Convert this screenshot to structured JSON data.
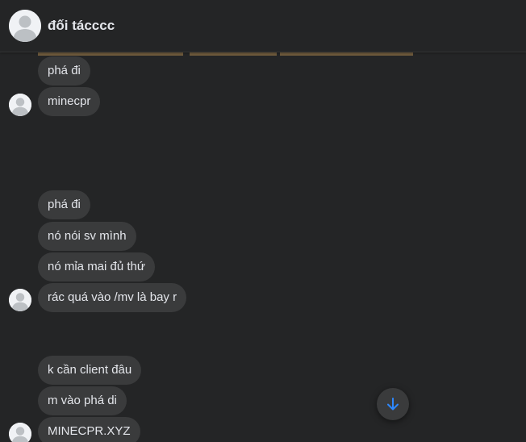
{
  "header": {
    "title": "đối tácccc"
  },
  "messages": [
    {
      "text": "phá đi"
    },
    {
      "text": "minecpr"
    },
    {
      "text": "phá đi"
    },
    {
      "text": "nó nói sv mình"
    },
    {
      "text": "nó mỉa mai đủ thứ"
    },
    {
      "text": "rác quá vào /mv là bay r"
    },
    {
      "text": "k cần client đâu"
    },
    {
      "text": "m vào phá di"
    },
    {
      "text": "MINECPR.XYZ"
    }
  ],
  "icons": {
    "avatar": "default-user-avatar-icon",
    "scroll": "arrow-down-icon"
  },
  "colors": {
    "background": "#242526",
    "bubble": "#3a3b3c",
    "text": "#e4e6eb",
    "accent": "#2d88ff"
  }
}
